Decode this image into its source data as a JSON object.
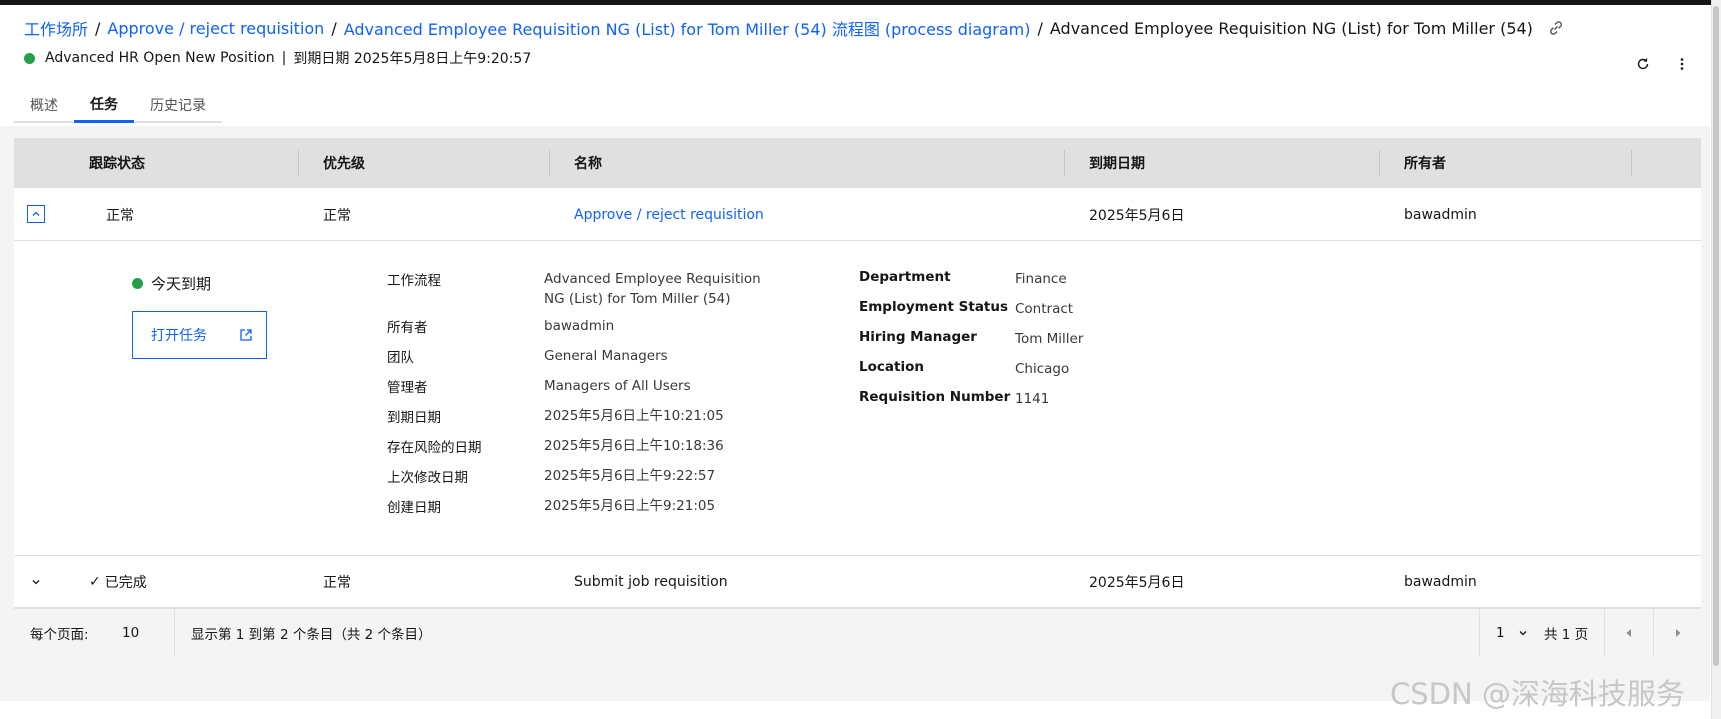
{
  "breadcrumb": {
    "items": [
      "工作场所",
      "Approve / reject requisition",
      "Advanced Employee Requisition NG (List) for Tom Miller (54) 流程图 (process diagram)"
    ],
    "separator": "/",
    "current": "Advanced Employee Requisition NG (List) for Tom Miller (54)",
    "link_icon": "link-icon"
  },
  "status": {
    "process_name": "Advanced HR Open New Position",
    "separator": "|",
    "due_label": "到期日期 2025年5月8日上午9:20:57",
    "color": "#24a148"
  },
  "header_actions": {
    "refresh_icon": "refresh-icon",
    "overflow_icon": "overflow-menu-vertical-icon"
  },
  "tabs": [
    {
      "label": "概述",
      "active": false
    },
    {
      "label": "任务",
      "active": true
    },
    {
      "label": "历史记录",
      "active": false
    }
  ],
  "table": {
    "columns": [
      "跟踪状态",
      "优先级",
      "名称",
      "到期日期",
      "所有者"
    ],
    "rows": [
      {
        "status": "正常",
        "priority": "正常",
        "name": "Approve / reject requisition",
        "due": "2025年5月6日",
        "owner": "bawadmin",
        "expanded": true,
        "status_icon": ""
      },
      {
        "status": "已完成",
        "priority": "正常",
        "name": "Submit job requisition",
        "due": "2025年5月6日",
        "owner": "bawadmin",
        "expanded": false,
        "status_icon": "✓"
      }
    ]
  },
  "detail": {
    "due_status": "今天到期",
    "open_task_label": "打开任务",
    "fields": [
      {
        "label": "工作流程",
        "value": "Advanced Employee Requisition NG (List) for Tom Miller (54)"
      },
      {
        "label": "所有者",
        "value": "bawadmin"
      },
      {
        "label": "团队",
        "value": "General Managers"
      },
      {
        "label": "管理者",
        "value": "Managers of All Users"
      },
      {
        "label": "到期日期",
        "value": "2025年5月6日上午10:21:05"
      },
      {
        "label": "存在风险的日期",
        "value": "2025年5月6日上午10:18:36"
      },
      {
        "label": "上次修改日期",
        "value": "2025年5月6日上午9:22:57"
      },
      {
        "label": "创建日期",
        "value": "2025年5月6日上午9:21:05"
      }
    ],
    "business_data": [
      {
        "label": "Department",
        "value": "Finance"
      },
      {
        "label": "Employment Status",
        "value": "Contract"
      },
      {
        "label": "Hiring Manager",
        "value": "Tom Miller"
      },
      {
        "label": "Location",
        "value": "Chicago"
      },
      {
        "label": "Requisition Number",
        "value": "1141"
      }
    ]
  },
  "pagination": {
    "per_page_label": "每个页面:",
    "per_page_value": "10",
    "range_text": "显示第 1 到第 2 个条目（共 2 个条目）",
    "page_value": "1",
    "total_pages": "共 1 页"
  },
  "watermark": "CSDN @深海科技服务",
  "colors": {
    "accent": "#0f62fe",
    "success": "#24a148",
    "header_bg": "#e0e0e0",
    "page_bg": "#f4f4f4"
  }
}
